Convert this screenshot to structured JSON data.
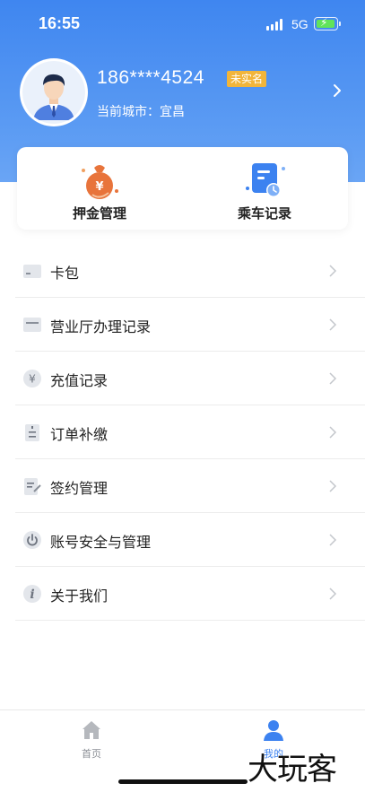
{
  "status_bar": {
    "time": "16:55",
    "network": "5G"
  },
  "profile": {
    "phone": "186****4524",
    "badge": "未实名",
    "city_label": "当前城市：",
    "city": "宜昌"
  },
  "quick_actions": [
    {
      "label": "押金管理",
      "icon": "money-bag-icon"
    },
    {
      "label": "乘车记录",
      "icon": "ride-record-icon"
    }
  ],
  "menu": [
    {
      "label": "卡包",
      "icon": "card-wallet-icon"
    },
    {
      "label": "营业厅办理记录",
      "icon": "service-hall-icon"
    },
    {
      "label": "充值记录",
      "icon": "yuan-icon"
    },
    {
      "label": "订单补缴",
      "icon": "order-icon"
    },
    {
      "label": "签约管理",
      "icon": "contract-icon"
    },
    {
      "label": "账号安全与管理",
      "icon": "power-icon"
    },
    {
      "label": "关于我们",
      "icon": "info-icon"
    }
  ],
  "tabbar": [
    {
      "label": "首页",
      "icon": "home-icon",
      "active": false
    },
    {
      "label": "我的",
      "icon": "user-icon",
      "active": true
    }
  ],
  "watermark": "大玩客",
  "colors": {
    "header": "#3f86f0",
    "badge": "#f2b53a",
    "accent_orange": "#e8743b",
    "accent_blue": "#3c82f0",
    "icon_gray": "#9aa0aa",
    "tab_inactive": "#b5b8bd"
  }
}
